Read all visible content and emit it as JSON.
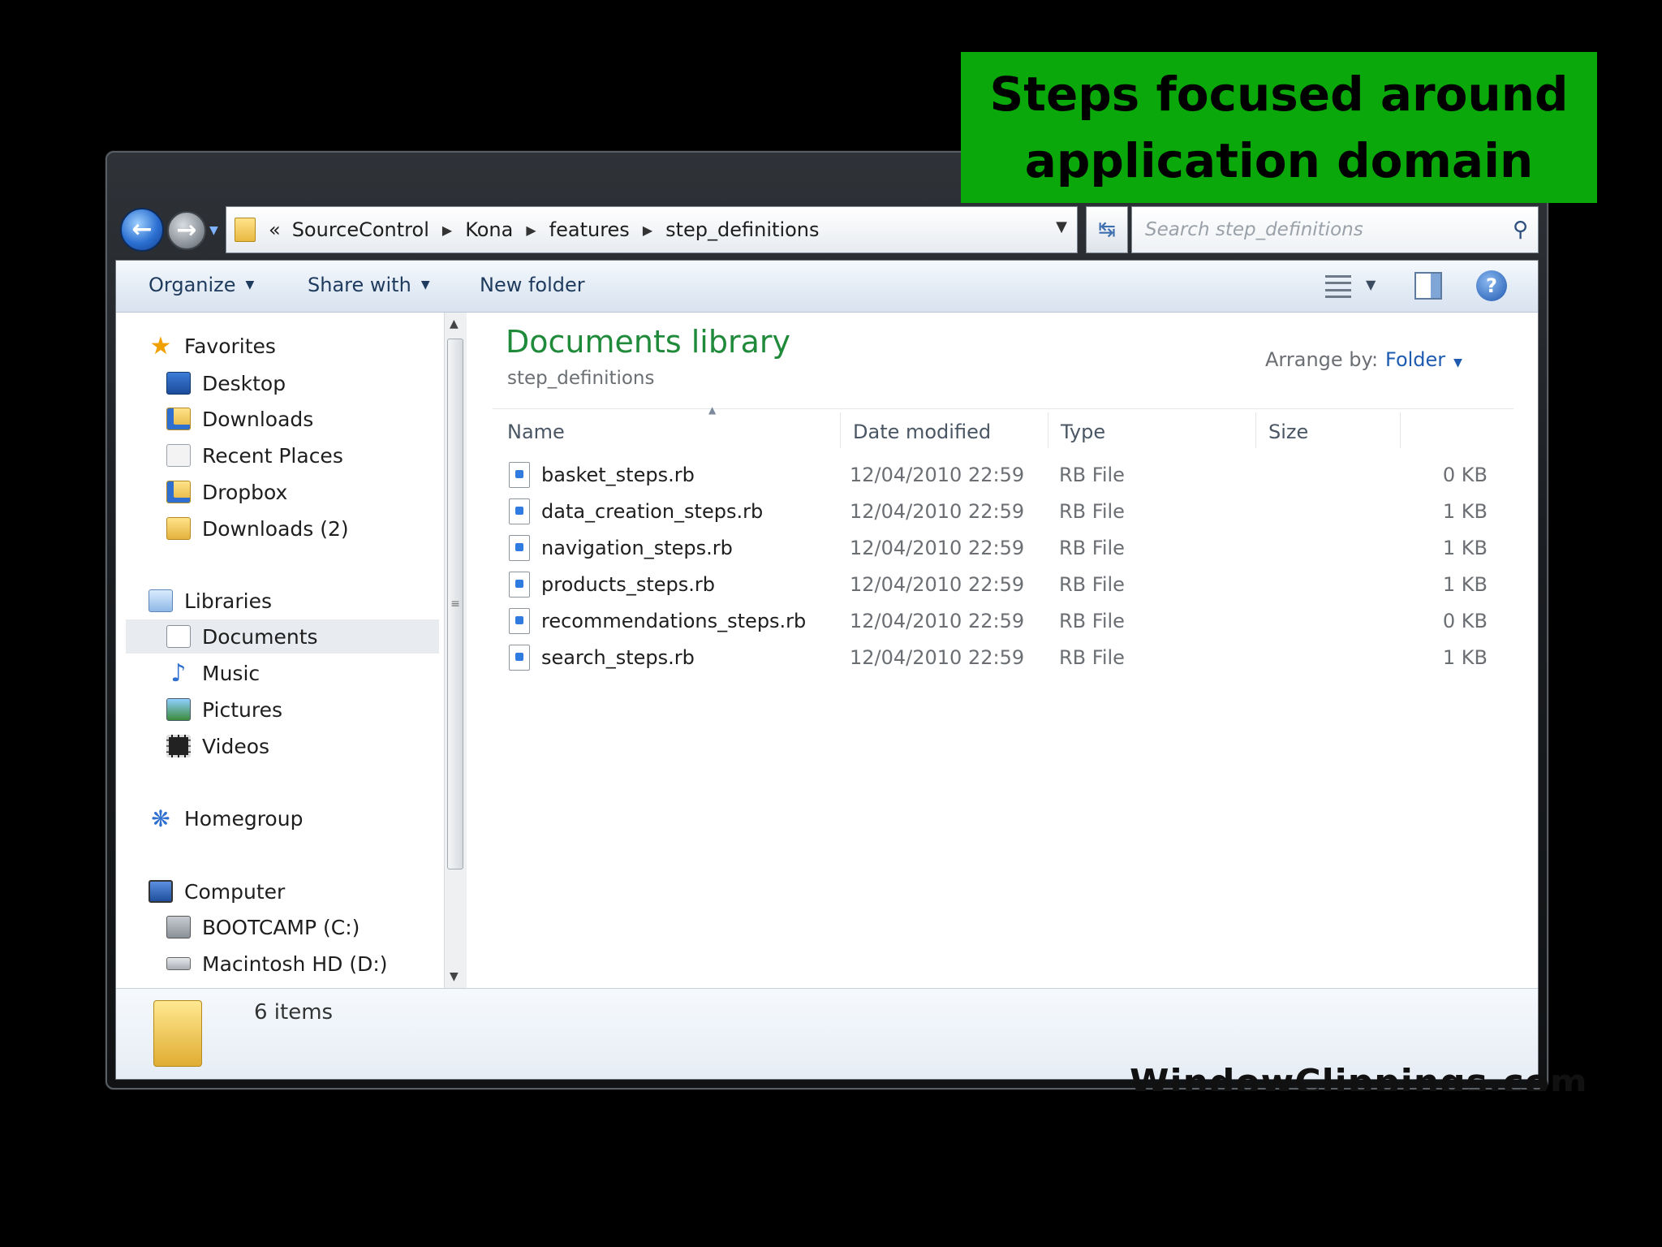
{
  "callout": {
    "text": "Steps focused around\napplication domain"
  },
  "address": {
    "lead": "«",
    "crumbs": [
      "SourceControl",
      "Kona",
      "features",
      "step_definitions"
    ],
    "search_placeholder": "Search step_definitions"
  },
  "toolbar": {
    "organize": "Organize",
    "share_with": "Share with",
    "new_folder": "New folder"
  },
  "nav": {
    "favorites": "Favorites",
    "desktop": "Desktop",
    "downloads": "Downloads",
    "recent_places": "Recent Places",
    "dropbox": "Dropbox",
    "downloads2": "Downloads (2)",
    "libraries": "Libraries",
    "documents": "Documents",
    "music": "Music",
    "pictures": "Pictures",
    "videos": "Videos",
    "homegroup": "Homegroup",
    "computer": "Computer",
    "drive_c": "BOOTCAMP (C:)",
    "drive_d": "Macintosh HD (D:)"
  },
  "library": {
    "title": "Documents library",
    "subtitle": "step_definitions",
    "arrange_label": "Arrange by:",
    "arrange_value": "Folder"
  },
  "columns": {
    "name": "Name",
    "date": "Date modified",
    "type": "Type",
    "size": "Size"
  },
  "files": [
    {
      "name": "basket_steps.rb",
      "date": "12/04/2010 22:59",
      "type": "RB File",
      "size": "0 KB"
    },
    {
      "name": "data_creation_steps.rb",
      "date": "12/04/2010 22:59",
      "type": "RB File",
      "size": "1 KB"
    },
    {
      "name": "navigation_steps.rb",
      "date": "12/04/2010 22:59",
      "type": "RB File",
      "size": "1 KB"
    },
    {
      "name": "products_steps.rb",
      "date": "12/04/2010 22:59",
      "type": "RB File",
      "size": "1 KB"
    },
    {
      "name": "recommendations_steps.rb",
      "date": "12/04/2010 22:59",
      "type": "RB File",
      "size": "0 KB"
    },
    {
      "name": "search_steps.rb",
      "date": "12/04/2010 22:59",
      "type": "RB File",
      "size": "1 KB"
    }
  ],
  "details": {
    "count": "6 items"
  },
  "watermark": "WindowClippings.com"
}
